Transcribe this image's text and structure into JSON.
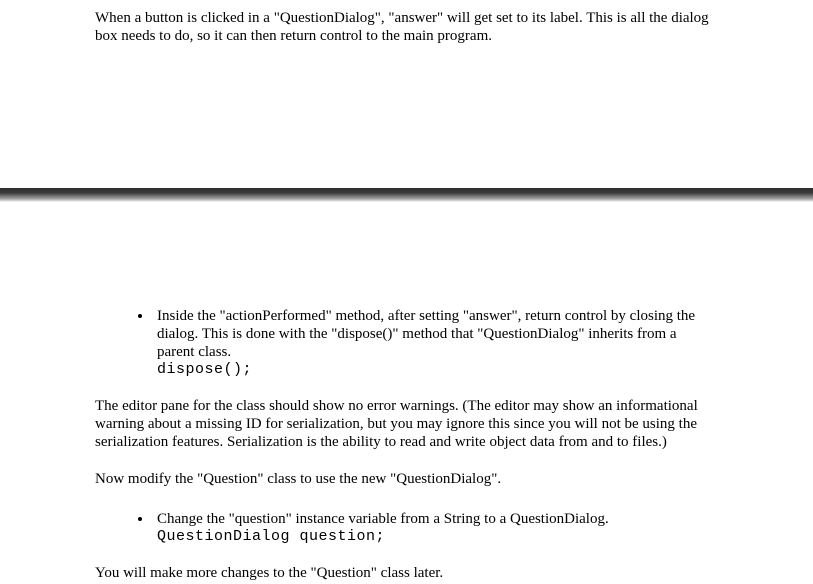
{
  "top": {
    "intro": "When a button is clicked in a \"QuestionDialog\", \"answer\" will get set to its label. This is all the dialog box needs to do, so it can then return control to the main program."
  },
  "bullet1": {
    "text": "Inside the \"actionPerformed\" method, after setting \"answer\", return control by closing the dialog. This is done with the \"dispose()\" method that \"QuestionDialog\" inherits from a parent class.",
    "code": "dispose();"
  },
  "para1": "The editor pane for the class should show no error warnings. (The editor may show an informational warning about a missing ID for serialization, but you may ignore this since you will not be using the serialization features. Serialization is the ability to read and write object data from and to files.)",
  "para2": "Now modify the \"Question\" class to use the new \"QuestionDialog\".",
  "bullet2": {
    "text": "Change the \"question\" instance variable from a String to a QuestionDialog.",
    "code": "QuestionDialog question;"
  },
  "para3": "You will make more changes to the \"Question\" class later."
}
